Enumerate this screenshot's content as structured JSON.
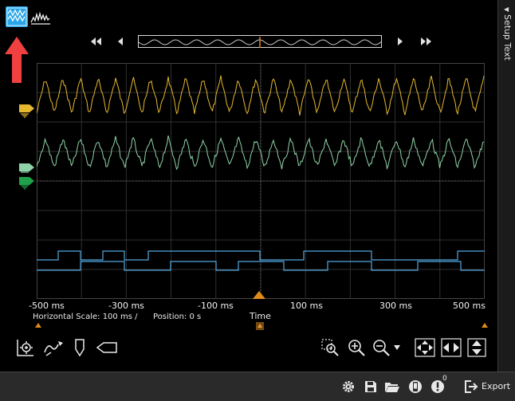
{
  "toolbar": {
    "waveform_view_icon": "waveform-view-icon",
    "spectrum_view_icon": "spectrum-view-icon"
  },
  "setup_panel": {
    "label": "Setup Text"
  },
  "time_axis": {
    "tick_labels": [
      "-500 ms",
      "-300 ms",
      "-100 ms",
      "100 ms",
      "300 ms",
      "500 ms"
    ],
    "label": "Time"
  },
  "status": {
    "horizontal_scale": "Horizontal Scale: 100 ms /",
    "position": "Position: 0 s"
  },
  "bottom_bar": {
    "export_label": "Export",
    "notification_count": "0"
  },
  "colors": {
    "channel1": "#e6b830",
    "channel2": "#8fd4a8",
    "channel2_ref": "#1fa04a",
    "digital": "#52a8e0",
    "accent": "#e08a1a",
    "highlight": "#2aa6e8",
    "annotation_arrow": "#f04040"
  }
}
